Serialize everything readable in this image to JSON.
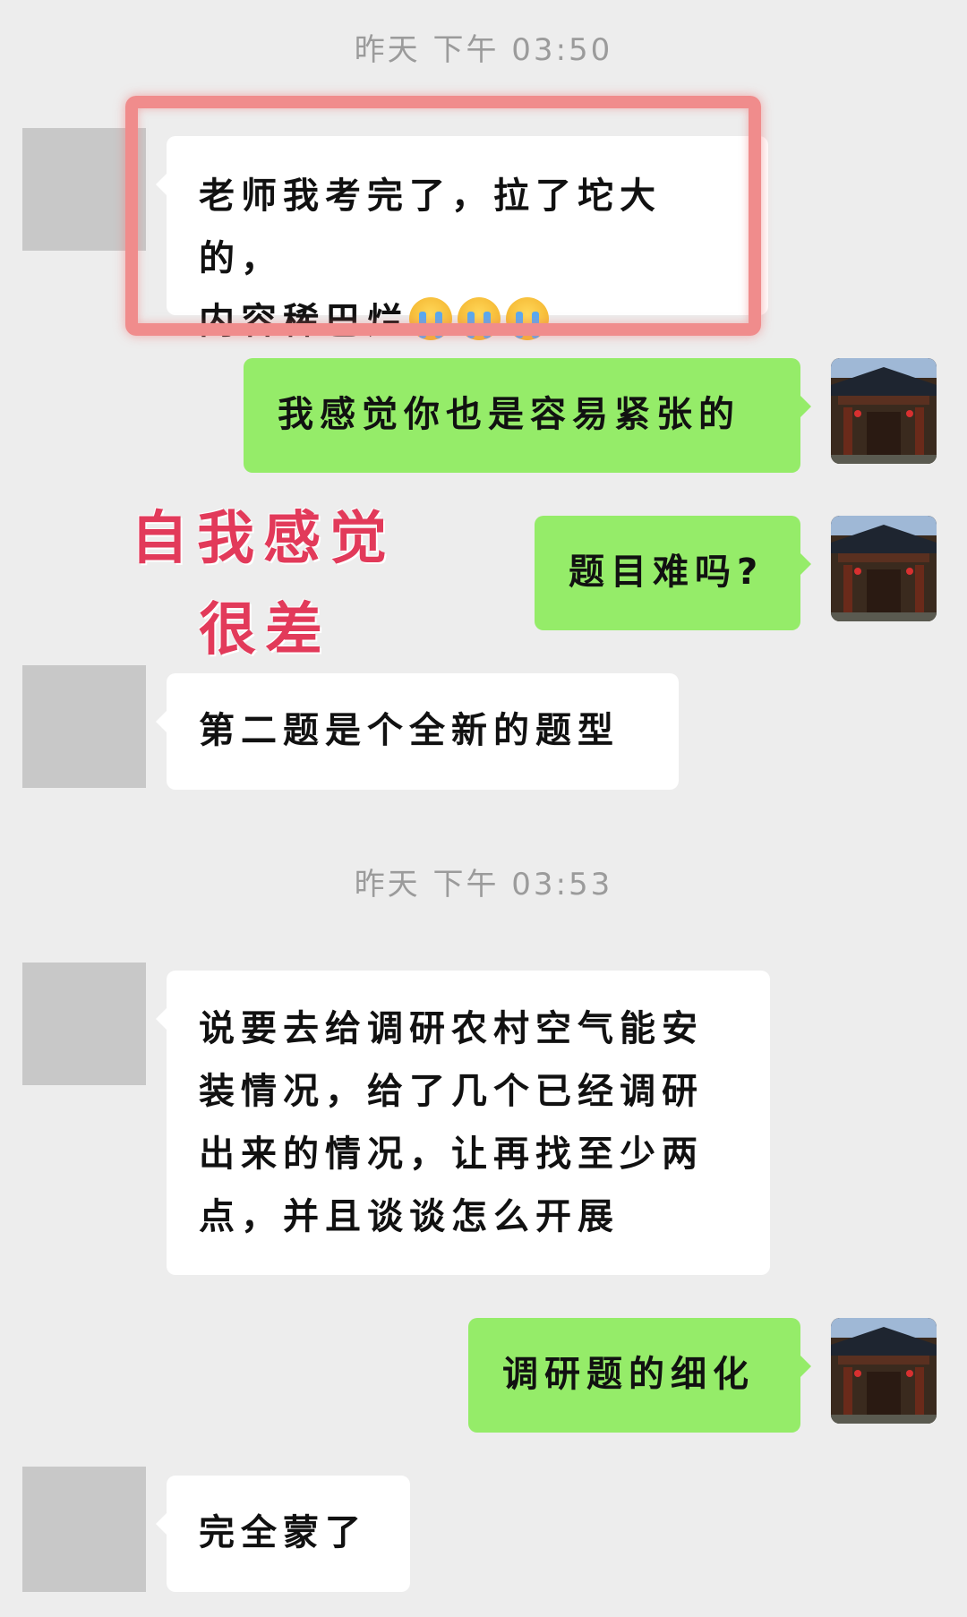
{
  "timestamps": [
    "昨天 下午 03:50",
    "昨天 下午 03:53"
  ],
  "messages": [
    {
      "side": "left",
      "text_line1": "老师我考完了，拉了坨大的，",
      "text_line2": "内容稀巴烂",
      "emoji": "loudly-crying-face x3"
    },
    {
      "side": "right",
      "text": "我感觉你也是容易紧张的"
    },
    {
      "side": "right",
      "text": "题目难吗?"
    },
    {
      "side": "left",
      "text": "第二题是个全新的题型"
    },
    {
      "side": "left",
      "lines": [
        "说要去给调研农村空气能安",
        "装情况，给了几个已经调研",
        "出来的情况，让再找至少两",
        "点，并且谈谈怎么开展"
      ]
    },
    {
      "side": "right",
      "text": "调研题的细化"
    },
    {
      "side": "left",
      "text": "完全蒙了"
    }
  ],
  "overlay": {
    "line1": "自我感觉",
    "line2": "很差",
    "color": "#e23a5a"
  },
  "colors": {
    "background": "#ededed",
    "incoming_bubble": "#ffffff",
    "outgoing_bubble": "#95ec69",
    "highlight": "#f08c8c"
  }
}
